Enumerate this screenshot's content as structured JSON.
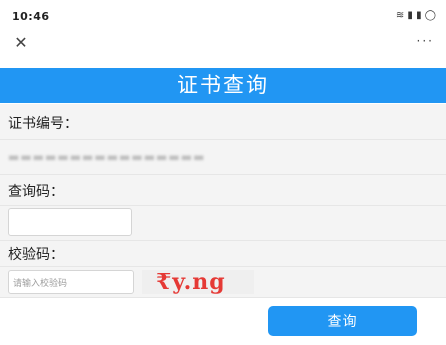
{
  "status_bar": {
    "time": "10:46",
    "indicators": "≋ ▮ ▮ ◯"
  },
  "nav": {
    "close_glyph": "✕",
    "more_glyph": "···"
  },
  "header": {
    "title": "证书查询"
  },
  "form": {
    "cert_label": "证书编号：",
    "cert_value": "▬▬▬▬▬▬▬▬▬▬▬▬▬▬▬▬",
    "query_code_label": "查询码：",
    "query_code_value": "",
    "verify_label": "校验码：",
    "verify_placeholder": "请输入校验码",
    "captcha_text": "₹y.ng"
  },
  "actions": {
    "query_label": "查询"
  },
  "colors": {
    "accent": "#2196f3",
    "captcha": "#e53935"
  }
}
